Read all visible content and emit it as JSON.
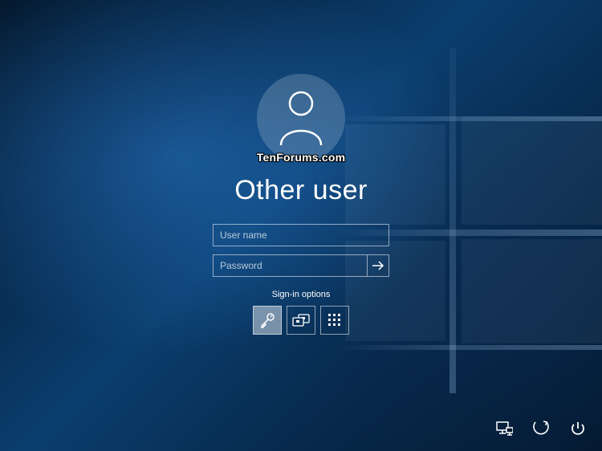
{
  "watermark": "TenForums.com",
  "user": {
    "display_name": "Other user"
  },
  "fields": {
    "username": {
      "placeholder": "User name",
      "value": ""
    },
    "password": {
      "placeholder": "Password",
      "value": ""
    }
  },
  "signin_options": {
    "label": "Sign-in options",
    "items": [
      {
        "id": "password",
        "icon": "key-icon",
        "selected": true
      },
      {
        "id": "smartcard",
        "icon": "smartcard-icon",
        "selected": false
      },
      {
        "id": "pin",
        "icon": "keypad-icon",
        "selected": false
      }
    ]
  },
  "system_buttons": {
    "network": "network-icon",
    "ease_of_access": "ease-of-access-icon",
    "power": "power-icon"
  },
  "colors": {
    "fg": "#ffffff",
    "border": "rgba(255,255,255,0.55)"
  }
}
